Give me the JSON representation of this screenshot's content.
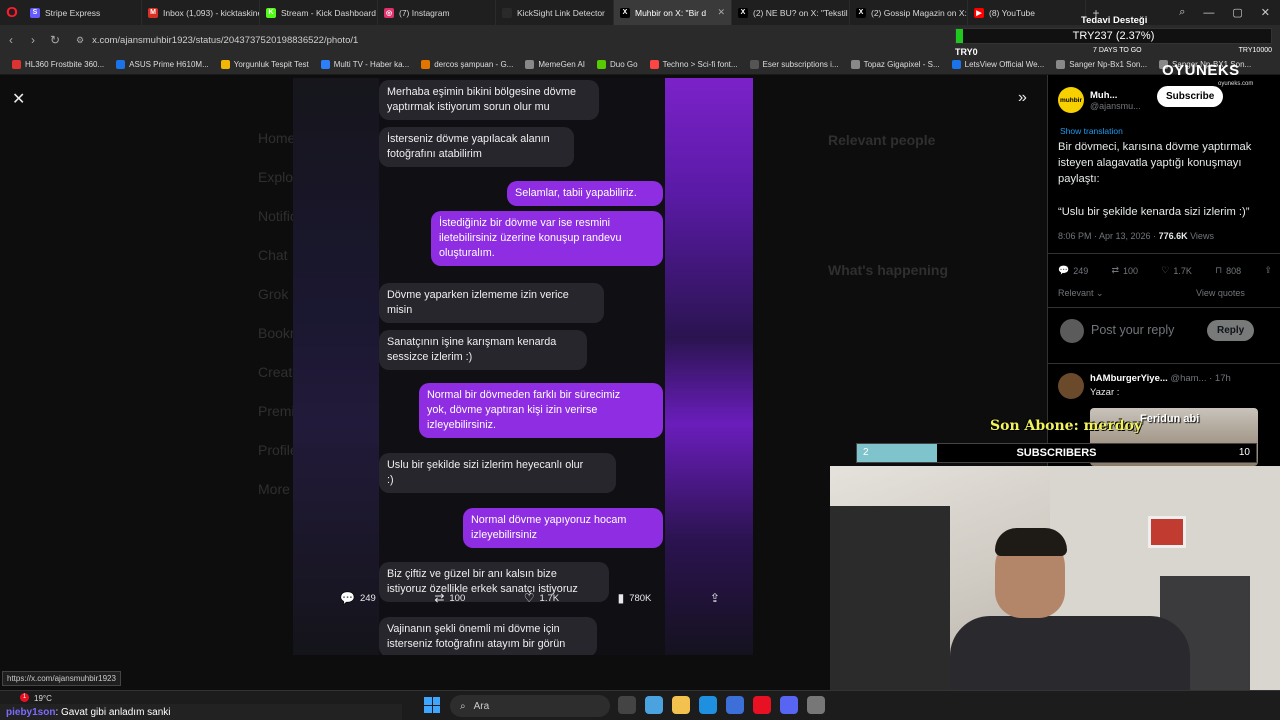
{
  "browser": {
    "tabs": [
      {
        "label": "Stripe Express",
        "color": "#635bff",
        "fav": "S",
        "active": false
      },
      {
        "label": "Inbox (1,093) - kicktaskine",
        "color": "#d93025",
        "fav": "M",
        "active": false
      },
      {
        "label": "Stream - Kick Dashboard",
        "color": "#53fc18",
        "fav": "K",
        "active": false
      },
      {
        "label": "(7) Instagram",
        "color": "#e1306c",
        "fav": "◎",
        "active": false
      },
      {
        "label": "KickSight Link Detector",
        "color": "#2a2a2a",
        "fav": "",
        "active": false
      },
      {
        "label": "Muhbir on X: \"Bir d",
        "color": "#000000",
        "fav": "X",
        "active": true
      },
      {
        "label": "(2) NE BU? on X: \"Tekstil a",
        "color": "#000000",
        "fav": "X",
        "active": false
      },
      {
        "label": "(2) Gossip Magazin on X:",
        "color": "#000000",
        "fav": "X",
        "active": false
      },
      {
        "label": "(8) YouTube",
        "color": "#ff0000",
        "fav": "▶",
        "active": false
      }
    ],
    "url": "x.com/ajansmuhbir1923/status/2043737520198836522/photo/1",
    "bookmarks": [
      "HL360 Frostbite 360...",
      "ASUS Prime H610M...",
      "Yorgunluk Tespit Test",
      "Multi TV - Haber ka...",
      "dercos şampuan - G...",
      "MemeGen AI",
      "Duo Go",
      "Techno > Sci-fi font...",
      "Eser subscriptions i...",
      "Topaz Gigapixel - S...",
      "LetsView Official We...",
      "Sanger Np-Bx1 Son...",
      "Sanger Np-BX1 Son..."
    ],
    "status_url": "https://x.com/ajansmuhbir1923"
  },
  "background_nav": [
    "Home",
    "Explore",
    "Notifications",
    "Chat",
    "Grok",
    "Bookmarks",
    "Creator Studio",
    "Premium",
    "Profile",
    "More"
  ],
  "background_right": {
    "relevant_people": "Relevant people",
    "whats_happening": "What's happening"
  },
  "chat": [
    {
      "side": "in",
      "text": "Merhaba eşimin bikini bölgesine dövme\nyaptırmak istiyorum sorun olur mu"
    },
    {
      "side": "in",
      "text": "İsterseniz dövme yapılacak alanın\nfotoğrafını atabilirim"
    },
    {
      "side": "out",
      "text": "Selamlar, tabii yapabiliriz."
    },
    {
      "side": "out",
      "text": "İstediğiniz bir dövme var ise resmini\niletebilirsiniz üzerine konuşup randevu\noluşturalım."
    },
    {
      "side": "in",
      "text": "Dövme yaparken izlememe izin verice\nmisin"
    },
    {
      "side": "in",
      "text": "Sanatçının işine karışmam kenarda\nsessizce izlerim :)"
    },
    {
      "side": "out",
      "text": "Normal bir dövmeden farklı bir sürecimiz\nyok, dövme yaptıran kişi izin verirse\nizleyebilirsiniz."
    },
    {
      "side": "in",
      "text": "Uslu bir şekilde sizi izlerim heyecanlı olur\n:)"
    },
    {
      "side": "out",
      "text": "Normal dövme yapıyoruz hocam\nizleyebilirsiniz"
    },
    {
      "side": "in",
      "text": "Biz çiftiz ve güzel bir anı kalsın bize\nistiyoruz özellikle erkek sanatçı istiyoruz"
    },
    {
      "side": "in",
      "text": "Vajinanın şekli önemli mi dövme için\nisterseniz fotoğrafını atayım bir görün"
    }
  ],
  "photo_actions": {
    "replies": "249",
    "reposts": "100",
    "likes": "1.7K",
    "views": "780K"
  },
  "tweet": {
    "author_name": "Muh...",
    "author_handle": "@ajansmu...",
    "subscribe_label": "Subscribe",
    "show_translation": "Show translation",
    "text": "Bir dövmeci, karısına dövme yaptırmak\nisteyen alagavatla yaptığı konuşmayı\npaylaştı:",
    "quote": "“Uslu bir şekilde kenarda sizi izlerim :)”",
    "time": "8:06 PM · Apr 13, 2026 · ",
    "views_count": "776.6K",
    "views_label": " Views",
    "stats": {
      "replies": "249",
      "reposts": "100",
      "likes": "1.7K",
      "bookmarks": "808"
    },
    "relevant_label": "Relevant",
    "view_quotes": "View quotes",
    "reply_placeholder": "Post your reply",
    "reply_button": "Reply",
    "comment_name": "hAMburgerYiye...",
    "comment_handle": "@ham...",
    "comment_time": "· 17h",
    "comment_text": "Yazar :"
  },
  "overlays": {
    "donation_title": "Tedavi Desteği",
    "donation_amount": "TRY237 (2.37%)",
    "donation_days": "7 DAYS TO GO",
    "donation_min": "TRY0",
    "donation_max": "TRY10000",
    "donation_progress": 0.0237,
    "sponsor_name": "OYUNEKS",
    "sponsor_url": "oyuneks.com",
    "last_sub": "Son Abone: merdoy",
    "subs_label": "SUBSCRIBERS",
    "subs_current": "2",
    "subs_goal": "10",
    "guest_label": "Feridun abi"
  },
  "taskbar": {
    "weather": "19°C",
    "chat_nick": "pieby1son",
    "chat_message": ": Gavat gibi anladım sanki",
    "search_label": "Ara",
    "notification_count": "1"
  },
  "colors": {
    "accent_purple": "#8e2de2",
    "x_blue": "#1d9bf0",
    "donation_green": "#1ec81e",
    "subs_fill": "#7fc4cc"
  }
}
